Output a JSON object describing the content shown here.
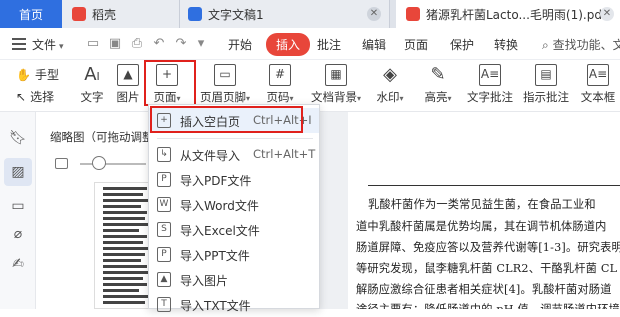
{
  "tabs": [
    {
      "label": "首页",
      "icon": "home-tab"
    },
    {
      "label": "稻壳",
      "icon": "daoke-icon",
      "color": "#e8463a"
    },
    {
      "label": "文字文稿1",
      "icon": "word-doc-icon",
      "color": "#2f6fe0"
    },
    {
      "label": "猪源乳杆菌Lacto...毛明雨(1).pdf",
      "icon": "pdf-icon",
      "color": "#e8463a"
    }
  ],
  "menu": {
    "file_label": "文件",
    "tabs": [
      "开始",
      "插入",
      "批注",
      "编辑",
      "页面",
      "保护",
      "转换"
    ],
    "active_tab": "插入",
    "search_text": "查找功能、文"
  },
  "ribbon": {
    "hand_tool": "手型",
    "select_tool": "选择",
    "buttons": [
      "文字",
      "图片",
      "页面",
      "页眉页脚",
      "页码",
      "文档背景",
      "水印",
      "高亮",
      "文字批注",
      "指示批注",
      "文本框"
    ]
  },
  "sidebar": {
    "icons": [
      "bookmark-icon",
      "thumbnail-icon",
      "comment-icon",
      "attachment-icon",
      "signature-icon"
    ]
  },
  "thumbnail_panel": {
    "title": "缩略图（可拖动调整",
    "zoom_fraction": 0.2
  },
  "dropdown": {
    "items": [
      {
        "label": "插入空白页",
        "shortcut": "Ctrl+Alt+I",
        "icon": "blank-page-icon"
      },
      {
        "label": "从文件导入",
        "shortcut": "Ctrl+Alt+T",
        "icon": "file-import-icon"
      },
      {
        "label": "导入PDF文件",
        "shortcut": "",
        "icon": "pdf-file-icon"
      },
      {
        "label": "导入Word文件",
        "shortcut": "",
        "icon": "word-file-icon"
      },
      {
        "label": "导入Excel文件",
        "shortcut": "",
        "icon": "excel-file-icon"
      },
      {
        "label": "导入PPT文件",
        "shortcut": "",
        "icon": "ppt-file-icon"
      },
      {
        "label": "导入图片",
        "shortcut": "",
        "icon": "image-file-icon"
      },
      {
        "label": "导入TXT文件",
        "shortcut": "",
        "icon": "txt-file-icon"
      }
    ]
  },
  "document": {
    "lines": [
      "乳酸杆菌作为一类常见益生菌，在食品工业和",
      "道中乳酸杆菌属是优势均属，其在调节机体肠道内",
      "肠道屏障、免疫应答以及营养代谢等[1-3]。研究表明",
      "等研究发现，鼠李糖乳杆菌 CLR2、干酪乳杆菌 CL",
      "解肠应激综合征患者相关症状[4]。乳酸杆菌对肠道",
      "途径主要有：降低肠道中的 pH 值、调节肠道内环境"
    ]
  },
  "colors": {
    "accent_red": "#e8463a",
    "home_blue": "#2f6fe0",
    "highlight_box": "#e0211c"
  }
}
